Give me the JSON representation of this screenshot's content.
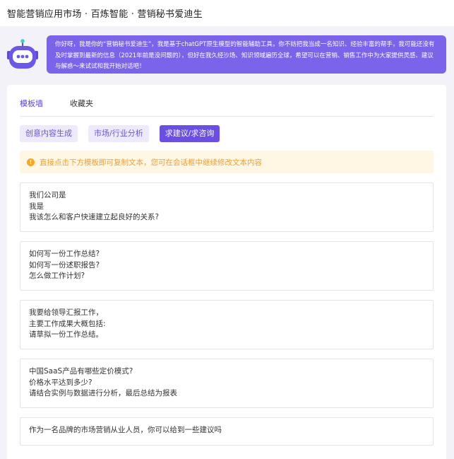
{
  "header": {
    "title": "智能营销应用市场 · 百炼智能 · 营销秘书爱迪生"
  },
  "assistant": {
    "avatar_icon": "robot-icon",
    "intro": "你好呀，我是你的“营销秘书爱迪生”，我是基于chatGPT原生模型的智能辅助工具，你不妨把我当成一名知识、经验丰富的帮手，我可能还没有及时掌握到最新的信息（2021年前是没问题的），但好在我久经沙场、知识领域遍历全球，希望可以在营销、销售工作中为大家提供灵感、建议与解惑～来试试和我开始对话吧！",
    "bubble_color": "#7b63ea"
  },
  "tabs": [
    {
      "label": "模板墙",
      "active": true
    },
    {
      "label": "收藏夹",
      "active": false
    }
  ],
  "categories": [
    {
      "label": "创意内容生成",
      "active": false
    },
    {
      "label": "市场/行业分析",
      "active": false
    },
    {
      "label": "求建议/求咨询",
      "active": true
    }
  ],
  "notice": {
    "icon": "warning-icon",
    "text": "直接点击下方模板即可复制文本，您可在会话框中继续修改文本内容"
  },
  "templates": [
    {
      "lines": [
        "我们公司是",
        "我是",
        "我该怎么和客户快速建立起良好的关系?"
      ]
    },
    {
      "lines": [
        "如何写一份工作总结?",
        "如何写一份述职报告?",
        "怎么做工作计划?"
      ]
    },
    {
      "lines": [
        "我要给领导汇报工作，",
        "主要工作成果大概包括:",
        "请草拟一份工作总结。"
      ]
    },
    {
      "lines": [
        "中国SaaS产品有哪些定价模式?",
        "价格水平达到多少?",
        "请结合实例与数据进行分析，最后总结为报表"
      ]
    },
    {
      "lines": [
        "作为一名品牌的市场营销从业人员，你可以给到一些建议吗"
      ]
    }
  ],
  "colors": {
    "accent": "#6a4fe2",
    "notice_text": "#e6a23c",
    "notice_bg": "#fff6e3"
  }
}
